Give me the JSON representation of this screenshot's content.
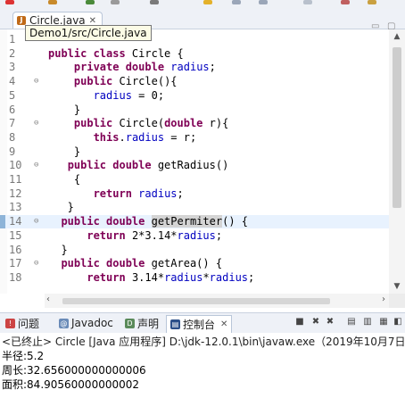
{
  "editor_tab": {
    "label": "Circle.java",
    "close": "✕"
  },
  "tooltip": "Demo1/src/Circle.java",
  "code_lines": [
    {
      "n": "1",
      "fold": "",
      "html": ""
    },
    {
      "n": "2",
      "fold": "",
      "html": "<span class='kw'>public class</span> Circle {"
    },
    {
      "n": "3",
      "fold": "",
      "html": "    <span class='kw'>private double</span> <span class='fld'>radius</span>;"
    },
    {
      "n": "4",
      "fold": "⊖",
      "html": "    <span class='kw'>public</span> Circle(){"
    },
    {
      "n": "5",
      "fold": "",
      "html": "       <span class='fld'>radius</span> = 0;"
    },
    {
      "n": "6",
      "fold": "",
      "html": "    }"
    },
    {
      "n": "7",
      "fold": "⊖",
      "html": "    <span class='kw'>public</span> Circle(<span class='kw'>double</span> r){"
    },
    {
      "n": "8",
      "fold": "",
      "html": "       <span class='kw'>this</span>.<span class='fld'>radius</span> = r;"
    },
    {
      "n": "9",
      "fold": "",
      "html": "    }"
    },
    {
      "n": "10",
      "fold": "⊖",
      "html": "   <span class='kw'>public double</span> getRadius()"
    },
    {
      "n": "11",
      "fold": "",
      "html": "    {"
    },
    {
      "n": "12",
      "fold": "",
      "html": "       <span class='kw'>return</span> <span class='fld'>radius</span>;"
    },
    {
      "n": "13",
      "fold": "",
      "html": "   }"
    },
    {
      "n": "14",
      "fold": "⊖",
      "html": "  <span class='kw'>public double</span> <span class='sel-word'>getPermiter</span>() {"
    },
    {
      "n": "15",
      "fold": "",
      "html": "      <span class='kw'>return</span> 2*3.14*<span class='fld'>radius</span>;"
    },
    {
      "n": "16",
      "fold": "",
      "html": "  }"
    },
    {
      "n": "17",
      "fold": "⊖",
      "html": "  <span class='kw'>public double</span> getArea() {"
    },
    {
      "n": "18",
      "fold": "",
      "html": "      <span class='kw'>return</span> 3.14*<span class='fld'>radius</span>*<span class='fld'>radius</span>;"
    }
  ],
  "bottom_tabs": [
    {
      "label": "问题",
      "icon": "problems-icon",
      "color": "#c44"
    },
    {
      "label": "Javadoc",
      "icon": "javadoc-icon",
      "color": "#6a8bb8"
    },
    {
      "label": "声明",
      "icon": "declaration-icon",
      "color": "#5a8a5a"
    },
    {
      "label": "控制台",
      "icon": "console-icon",
      "color": "#2b4f8a",
      "close": "✕"
    }
  ],
  "console": {
    "header": "<已终止> Circle [Java 应用程序] D:\\jdk-12.0.1\\bin\\javaw.exe（2019年10月7日",
    "lines": [
      "半径:5.2",
      "周长:32.656000000000006",
      "面积:84.90560000000002"
    ]
  },
  "colors": {
    "keyword": "#7f0055",
    "field": "#0000c0",
    "current_line": "#e8f2fe"
  }
}
